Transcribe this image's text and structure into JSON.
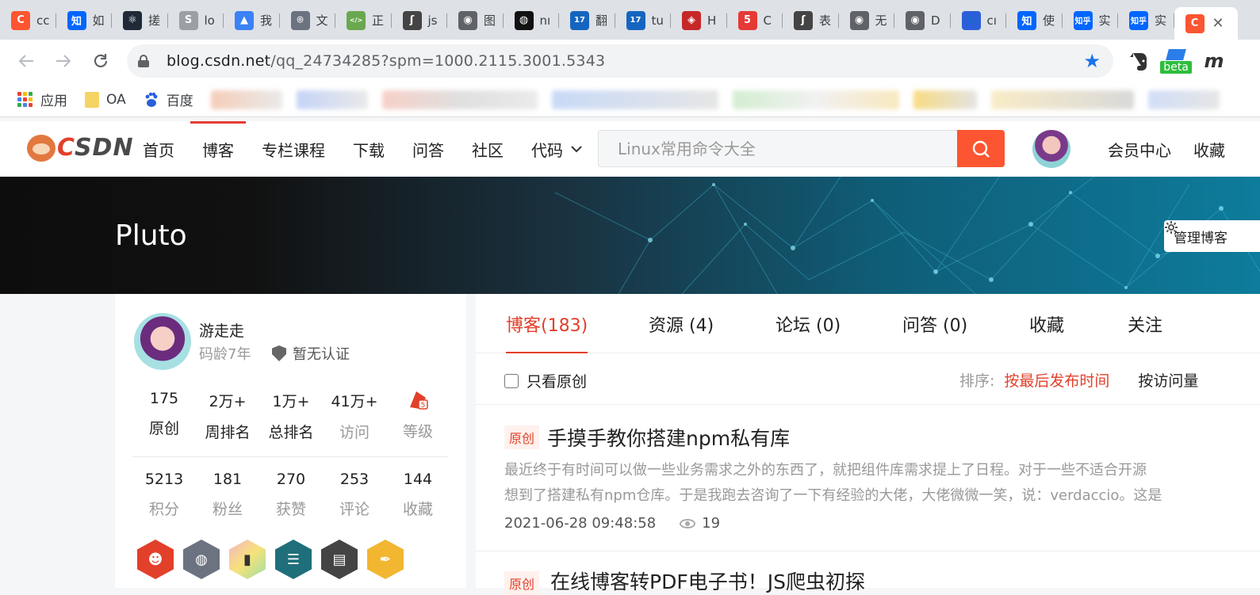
{
  "browser": {
    "tabs": [
      {
        "favicon": "C",
        "color": "#fc5531",
        "label": "cc"
      },
      {
        "favicon": "知",
        "color": "#0066ff",
        "label": "如"
      },
      {
        "favicon": "⚛",
        "color": "#1f2937",
        "label": "搓"
      },
      {
        "favicon": "S",
        "color": "#9aa0a6",
        "label": "lo"
      },
      {
        "favicon": "▲",
        "color": "#3b82f6",
        "label": "我"
      },
      {
        "favicon": "⌾",
        "color": "#6b7280",
        "label": "文"
      },
      {
        "favicon": "</>",
        "color": "#6aa84f",
        "label": "正"
      },
      {
        "favicon": "ʃ",
        "color": "#444444",
        "label": "js"
      },
      {
        "favicon": "◉",
        "color": "#5f6368",
        "label": "图"
      },
      {
        "favicon": "◍",
        "color": "#111111",
        "label": "nı"
      },
      {
        "favicon": "17",
        "color": "#1565c0",
        "label": "翻"
      },
      {
        "favicon": "17",
        "color": "#1565c0",
        "label": "tu"
      },
      {
        "favicon": "◈",
        "color": "#c62828",
        "label": "H"
      },
      {
        "favicon": "5",
        "color": "#e53935",
        "label": "C"
      },
      {
        "favicon": "ʃ",
        "color": "#444444",
        "label": "表"
      },
      {
        "favicon": "◉",
        "color": "#5f6368",
        "label": "无"
      },
      {
        "favicon": "◉",
        "color": "#5f6368",
        "label": "D"
      },
      {
        "favicon": "🐾",
        "color": "#2b5fd9",
        "label": "cı"
      },
      {
        "favicon": "知",
        "color": "#0066ff",
        "label": "使"
      },
      {
        "favicon": "知乎",
        "color": "#0066ff",
        "label": "实"
      },
      {
        "favicon": "知乎",
        "color": "#0066ff",
        "label": "实"
      }
    ],
    "active_tab": {
      "favicon": "C",
      "color": "#fc5531"
    },
    "url_host": "blog.csdn.net",
    "url_path": "/qq_24734285?spm=1000.2115.3001.5343",
    "beta_label": "beta",
    "ext_m_label": "m",
    "bookmarks": [
      {
        "label": "应用",
        "icon": "apps-grid-icon"
      },
      {
        "label": "OA",
        "icon": "folder-icon"
      },
      {
        "label": "百度",
        "icon": "baidu-paw-icon"
      }
    ]
  },
  "site": {
    "logo_text": "CSDN",
    "nav": [
      "首页",
      "博客",
      "专栏课程",
      "下载",
      "问答",
      "社区",
      "代码"
    ],
    "active_nav": "博客",
    "search_placeholder": "Linux常用命令大全",
    "member_center": "会员中心",
    "favorites": "收藏",
    "accent": "#fc5531"
  },
  "banner": {
    "blog_name": "Pluto",
    "manage_label": "管理博客"
  },
  "profile": {
    "name": "游走走",
    "code_age": "码龄7年",
    "cert": "暂无认证",
    "stats_row1": [
      {
        "num": "175",
        "label": "原创"
      },
      {
        "num": "2万+",
        "label": "周排名"
      },
      {
        "num": "1万+",
        "label": "总排名"
      },
      {
        "num": "41万+",
        "label": "访问"
      },
      {
        "num": "",
        "label": "等级"
      }
    ],
    "stats_row2": [
      {
        "num": "5213",
        "label": "积分"
      },
      {
        "num": "181",
        "label": "粉丝"
      },
      {
        "num": "270",
        "label": "获赞"
      },
      {
        "num": "253",
        "label": "评论"
      },
      {
        "num": "144",
        "label": "收藏"
      }
    ]
  },
  "content": {
    "tabs": [
      "博客(183)",
      "资源 (4)",
      "论坛 (0)",
      "问答 (0)",
      "收藏",
      "关注"
    ],
    "only_original": "只看原创",
    "sort_label": "排序:",
    "sort_by_time": "按最后发布时间",
    "sort_by_visits": "按访问量",
    "articles": [
      {
        "tag": "原创",
        "title": "手摸手教你搭建npm私有库",
        "desc_line1": "最近终于有时间可以做一些业务需求之外的东西了，就把组件库需求提上了日程。对于一些不适合开源",
        "desc_line2": "想到了搭建私有npm仓库。于是我跑去咨询了一下有经验的大佬，大佬微微一笑，说：verdaccio。这是",
        "date": "2021-06-28 09:48:58",
        "views": "19"
      }
    ],
    "next_tag": "原创",
    "next_title": "在线博客转PDF电子书！JS爬虫初探"
  }
}
